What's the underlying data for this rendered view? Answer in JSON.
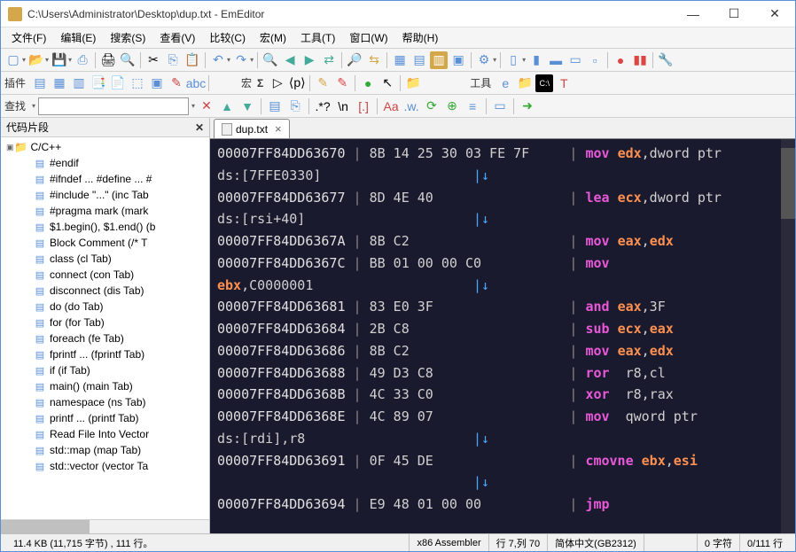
{
  "window": {
    "title": "C:\\Users\\Administrator\\Desktop\\dup.txt - EmEditor"
  },
  "menu": [
    "文件(F)",
    "编辑(E)",
    "搜索(S)",
    "查看(V)",
    "比较(C)",
    "宏(M)",
    "工具(T)",
    "窗口(W)",
    "帮助(H)"
  ],
  "toolbar2_label": "插件",
  "toolbar3_labels": {
    "macro": "宏",
    "sigma": "Σ",
    "tools": "工具"
  },
  "findbar": {
    "label": "查找",
    "placeholder": ""
  },
  "sidebar": {
    "title": "代码片段",
    "root": "C/C++",
    "items": [
      "#endif",
      "#ifndef ... #define ... #",
      "#include \"...\"  (inc Tab",
      "#pragma mark  (mark",
      "$1.begin(), $1.end()  (b",
      "Block Comment  (/* T",
      "class  (cl Tab)",
      "connect  (con Tab)",
      "disconnect  (dis Tab)",
      "do  (do Tab)",
      "for  (for Tab)",
      "foreach  (fe Tab)",
      "fprintf ...  (fprintf Tab)",
      "if  (if Tab)",
      "main()  (main Tab)",
      "namespace  (ns Tab)",
      "printf ...  (printf Tab)",
      "Read File Into Vector",
      "std::map  (map Tab)",
      "std::vector  (vector Ta"
    ]
  },
  "tab": {
    "label": "dup.txt"
  },
  "code_lines": [
    {
      "addr": "00007FF84DD63670",
      "bytes": "8B 14 25 30 03 FE 7F",
      "mn": "mov",
      "ops": [
        {
          "t": "reg",
          "v": "edx"
        },
        {
          "t": "kw",
          "v": ",dword ptr"
        }
      ],
      "arrow": false
    },
    {
      "cont": true,
      "pre": "ds:[7FFE0330]",
      "arrow": true
    },
    {
      "addr": "00007FF84DD63677",
      "bytes": "8D 4E 40",
      "mn": "lea",
      "ops": [
        {
          "t": "reg",
          "v": "ecx"
        },
        {
          "t": "kw",
          "v": ",dword ptr"
        }
      ],
      "arrow": false
    },
    {
      "cont": true,
      "pre": "ds:[rsi+40]",
      "arrow": true
    },
    {
      "addr": "00007FF84DD6367A",
      "bytes": "8B C2",
      "mn": "mov",
      "ops": [
        {
          "t": "reg",
          "v": "eax"
        },
        {
          "t": "kw",
          "v": ","
        },
        {
          "t": "reg",
          "v": "edx"
        }
      ],
      "arrow": true,
      "far": true
    },
    {
      "addr": "00007FF84DD6367C",
      "bytes": "BB 01 00 00 C0",
      "mn": "mov",
      "ops": [],
      "arrow": false
    },
    {
      "cont": true,
      "pre_reg": "ebx",
      "pre_rest": ",C0000001",
      "arrow": true
    },
    {
      "addr": "00007FF84DD63681",
      "bytes": "83 E0 3F",
      "mn": "and",
      "ops": [
        {
          "t": "reg",
          "v": "eax"
        },
        {
          "t": "kw",
          "v": ",3F"
        }
      ],
      "arrow": true,
      "far": true
    },
    {
      "addr": "00007FF84DD63684",
      "bytes": "2B C8",
      "mn": "sub",
      "ops": [
        {
          "t": "reg",
          "v": "ecx"
        },
        {
          "t": "kw",
          "v": ","
        },
        {
          "t": "reg",
          "v": "eax"
        }
      ],
      "arrow": true,
      "far": true
    },
    {
      "addr": "00007FF84DD63686",
      "bytes": "8B C2",
      "mn": "mov",
      "ops": [
        {
          "t": "reg",
          "v": "eax"
        },
        {
          "t": "kw",
          "v": ","
        },
        {
          "t": "reg",
          "v": "edx"
        }
      ],
      "arrow": true,
      "far": true
    },
    {
      "addr": "00007FF84DD63688",
      "bytes": "49 D3 C8",
      "mn": "ror",
      "ops": [
        {
          "t": "reg2",
          "v": " r8,cl"
        }
      ],
      "arrow": true,
      "far": true
    },
    {
      "addr": "00007FF84DD6368B",
      "bytes": "4C 33 C0",
      "mn": "xor",
      "ops": [
        {
          "t": "reg2",
          "v": " r8,rax"
        }
      ],
      "arrow": true,
      "far": true
    },
    {
      "addr": "00007FF84DD6368E",
      "bytes": "4C 89 07",
      "mn": "mov",
      "ops": [
        {
          "t": "kw",
          "v": " qword ptr"
        }
      ],
      "arrow": false
    },
    {
      "cont": true,
      "pre": "ds:[rdi],r8",
      "arrow": true
    },
    {
      "addr": "00007FF84DD63691",
      "bytes": "0F 45 DE",
      "mn": "cmovne",
      "ops": [
        {
          "t": "reg",
          "v": "ebx"
        },
        {
          "t": "kw",
          "v": ","
        },
        {
          "t": "reg",
          "v": "esi"
        }
      ],
      "arrow": false
    },
    {
      "cont": true,
      "pre": "",
      "arrow": true
    },
    {
      "addr": "00007FF84DD63694",
      "bytes": "E9 48 01 00 00",
      "mn": "jmp",
      "ops": [],
      "arrow": false
    }
  ],
  "status": {
    "left": "11.4 KB (11,715 字节) , 111 行。",
    "lang": "x86 Assembler",
    "pos": "行 7,列 70",
    "enc": "简体中文(GB2312)",
    "chars": "0 字符",
    "lines": "0/111 行"
  }
}
